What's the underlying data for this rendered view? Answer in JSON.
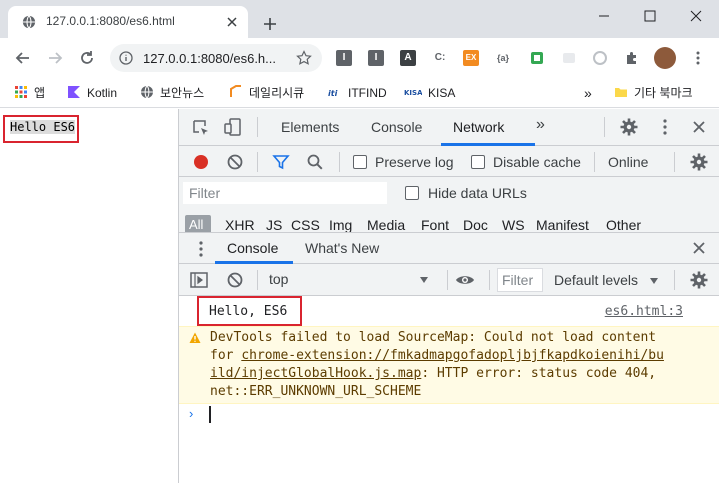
{
  "browser": {
    "tab_title": "127.0.0.1:8080/es6.html",
    "url": "127.0.0.1:8080/es6.h...",
    "extensions": [
      "I",
      "I",
      "A",
      "C:",
      "EX",
      "{a}"
    ]
  },
  "bookmarks": {
    "apps_label": "앱",
    "items": [
      "Kotlin",
      "보안뉴스",
      "데일리시큐",
      "ITFIND",
      "KISA"
    ],
    "more": "»",
    "other_folder": "기타 북마크"
  },
  "page": {
    "text": "Hello ES6"
  },
  "devtools": {
    "tabs": [
      "Elements",
      "Console",
      "Network"
    ],
    "more_tabs": "»",
    "network": {
      "preserve_log": "Preserve log",
      "disable_cache": "Disable cache",
      "throttle": "Online",
      "filter_placeholder": "Filter",
      "hide_data_urls": "Hide data URLs",
      "types": [
        "All",
        "XHR",
        "JS",
        "CSS",
        "Img",
        "Media",
        "Font",
        "Doc",
        "WS",
        "Manifest",
        "Other"
      ]
    },
    "drawer": {
      "tabs": [
        "Console",
        "What's New"
      ]
    },
    "console": {
      "context": "top",
      "filter_placeholder": "Filter",
      "levels": "Default levels",
      "log": {
        "text": "Hello, ES6",
        "source": "es6.html:3"
      },
      "warning": {
        "line1": "DevTools failed to load SourceMap: Could not load content",
        "line2_prefix": "for ",
        "link_part1": "chrome-extension://fmkadmapgofadopljbjfkapdkoienihi/bu",
        "link_part2": "ild/injectGlobalHook.js.map",
        "line3_suffix": ": HTTP error: status code 404,",
        "line4": "net::ERR_UNKNOWN_URL_SCHEME"
      },
      "prompt": "›"
    }
  },
  "colors": {
    "accent_blue": "#1a73e8",
    "record_red": "#d93025",
    "highlight_red": "#d9242f",
    "warning_bg": "#fffbe5",
    "warning_text": "#5c3c00"
  }
}
